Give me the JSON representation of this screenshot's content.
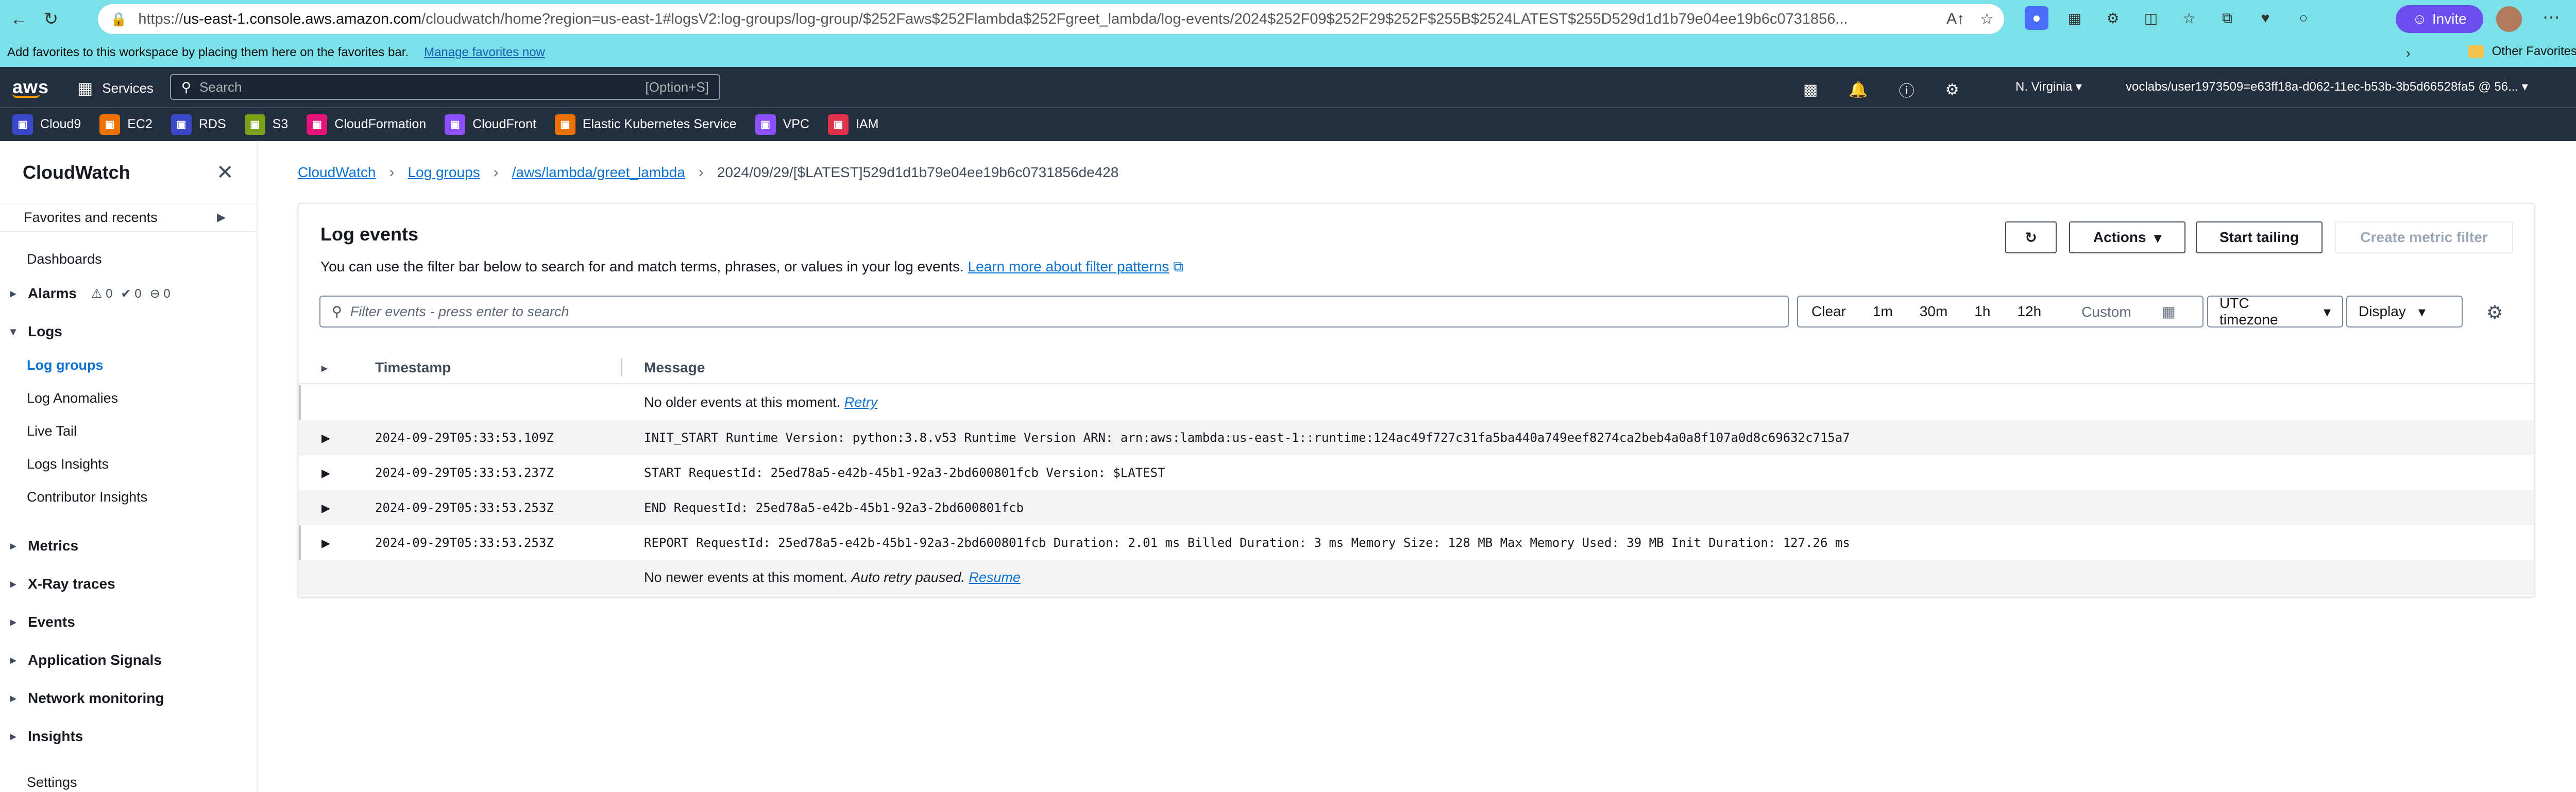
{
  "browser": {
    "url_prefix": "https://",
    "url_host": "us-east-1.console.aws.amazon.com",
    "url_rest": "/cloudwatch/home?region=us-east-1#logsV2:log-groups/log-group/$252Faws$252Flambda$252Fgreet_lambda/log-events/2024$252F09$252F29$252F$255B$2524LATEST$255D529d1d1b79e04ee19b6c0731856...",
    "invite_label": "Invite"
  },
  "favorites_bar": {
    "text": "Add favorites to this workspace by placing them here on the favorites bar.",
    "link": "Manage favorites now",
    "other": "Other Favorites"
  },
  "aws_nav": {
    "logo": "aws",
    "services": "Services",
    "search_placeholder": "Search",
    "search_shortcut": "[Option+S]",
    "region": "N. Virginia",
    "account": "voclabs/user1973509=e63ff18a-d062-11ec-b53b-3b5d66528fa5 @ 56..."
  },
  "service_shortcuts": [
    {
      "label": "Cloud9",
      "color": "#3b48cc"
    },
    {
      "label": "EC2",
      "color": "#ed7100"
    },
    {
      "label": "RDS",
      "color": "#3b48cc"
    },
    {
      "label": "S3",
      "color": "#7aa116"
    },
    {
      "label": "CloudFormation",
      "color": "#e7157b"
    },
    {
      "label": "CloudFront",
      "color": "#8c4fff"
    },
    {
      "label": "Elastic Kubernetes Service",
      "color": "#ed7100"
    },
    {
      "label": "VPC",
      "color": "#8c4fff"
    },
    {
      "label": "IAM",
      "color": "#dd344c"
    }
  ],
  "sidebar": {
    "title": "CloudWatch",
    "favorites": "Favorites and recents",
    "dashboards": "Dashboards",
    "alarms": "Alarms",
    "alarm_counts": [
      "0",
      "0",
      "0"
    ],
    "logs": "Logs",
    "log_items": [
      "Log groups",
      "Log Anomalies",
      "Live Tail",
      "Logs Insights",
      "Contributor Insights"
    ],
    "sections": [
      "Metrics",
      "X-Ray traces",
      "Events",
      "Application Signals",
      "Network monitoring",
      "Insights"
    ],
    "settings": "Settings"
  },
  "breadcrumb": {
    "items": [
      "CloudWatch",
      "Log groups",
      "/aws/lambda/greet_lambda"
    ],
    "current": "2024/09/29/[$LATEST]529d1d1b79e04ee19b6c0731856de428"
  },
  "panel": {
    "title": "Log events",
    "description": "You can use the filter bar below to search for and match terms, phrases, or values in your log events.",
    "learn_more": "Learn more about filter patterns",
    "actions": "Actions",
    "start_tailing": "Start tailing",
    "create_metric_filter": "Create metric filter",
    "filter_placeholder": "Filter events - press enter to search",
    "clear": "Clear",
    "ranges": [
      "1m",
      "30m",
      "1h",
      "12h"
    ],
    "custom": "Custom",
    "timezone": "UTC timezone",
    "display": "Display"
  },
  "table": {
    "col_timestamp": "Timestamp",
    "col_message": "Message",
    "no_older": "No older events at this moment.",
    "retry": "Retry",
    "rows": [
      {
        "ts": "2024-09-29T05:33:53.109Z",
        "msg": "INIT_START Runtime Version: python:3.8.v53 Runtime Version ARN: arn:aws:lambda:us-east-1::runtime:124ac49f727c31fa5ba440a749eef8274ca2beb4a0a8f107a0d8c69632c715a7"
      },
      {
        "ts": "2024-09-29T05:33:53.237Z",
        "msg": "START RequestId: 25ed78a5-e42b-45b1-92a3-2bd600801fcb Version: $LATEST"
      },
      {
        "ts": "2024-09-29T05:33:53.253Z",
        "msg": "END RequestId: 25ed78a5-e42b-45b1-92a3-2bd600801fcb"
      },
      {
        "ts": "2024-09-29T05:33:53.253Z",
        "msg": "REPORT RequestId: 25ed78a5-e42b-45b1-92a3-2bd600801fcb Duration: 2.01 ms Billed Duration: 3 ms Memory Size: 128 MB Max Memory Used: 39 MB Init Duration: 127.26 ms"
      }
    ],
    "no_newer": "No newer events at this moment.",
    "auto_retry": "Auto retry paused.",
    "resume": "Resume"
  }
}
